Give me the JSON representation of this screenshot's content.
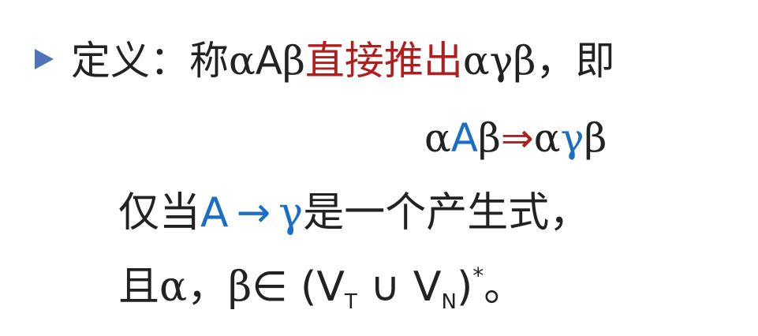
{
  "definition": {
    "bullet_icon": "triangle-right-icon",
    "lead": "定义：称",
    "alpha": "α",
    "A": "A",
    "beta": "β",
    "highlight": "直接推出",
    "result": "αγβ",
    "tail": "，即"
  },
  "formula": {
    "alpha": "α",
    "A": "A",
    "beta": "β",
    "arrow": "⇒",
    "alpha2": "α",
    "gamma": "γ",
    "beta2": "β"
  },
  "condition1": {
    "lead": "仅当",
    "A": "A",
    "arrow": "→",
    "gamma": "γ",
    "tail": "是一个产生式，"
  },
  "condition2": {
    "lead": "且",
    "alpha": "α",
    "sep": "，",
    "beta": "β",
    "elem": "∈",
    "open": "(V",
    "sub_t": "T",
    "union": " ∪ V",
    "sub_n": "N",
    "close": ")",
    "star": "*",
    "end": "。"
  },
  "colors": {
    "red": "#b01e1e",
    "blue": "#1a6ec4",
    "bullet": "#4f74b8",
    "text": "#222222"
  }
}
